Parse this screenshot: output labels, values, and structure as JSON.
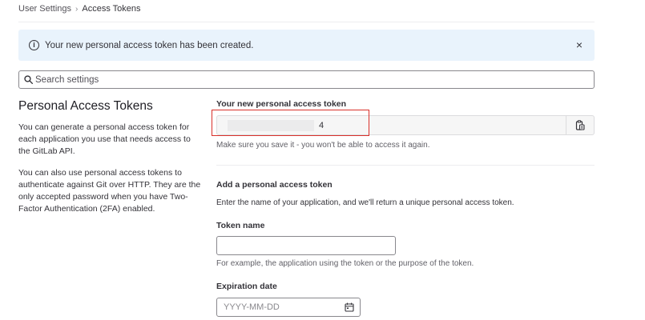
{
  "breadcrumb": {
    "parent": "User Settings",
    "separator": "›",
    "current": "Access Tokens"
  },
  "alert": {
    "message": "Your new personal access token has been created.",
    "close_symbol": "×"
  },
  "search": {
    "placeholder": "Search settings"
  },
  "intro": {
    "title": "Personal Access Tokens",
    "paragraph_1": "You can generate a personal access token for each application you use that needs access to the GitLab API.",
    "paragraph_2": "You can also use personal access tokens to authenticate against Git over HTTP. They are the only accepted password when you have Two-Factor Authentication (2FA) enabled."
  },
  "new_token": {
    "label": "Your new personal access token",
    "value_suffix": "4",
    "help": "Make sure you save it - you won't be able to access it again."
  },
  "add_token": {
    "heading": "Add a personal access token",
    "description": "Enter the name of your application, and we'll return a unique personal access token.",
    "name_label": "Token name",
    "name_value": "",
    "name_help": "For example, the application using the token or the purpose of the token.",
    "expiration_label": "Expiration date",
    "expiration_placeholder": "YYYY-MM-DD",
    "expiration_value": ""
  },
  "colors": {
    "alert_background": "#e9f3fc",
    "highlight_border": "#d9302a",
    "text_primary": "#333238"
  },
  "icons": [
    "info-icon",
    "close-icon",
    "search-icon",
    "copy-clipboard-icon",
    "calendar-icon"
  ]
}
